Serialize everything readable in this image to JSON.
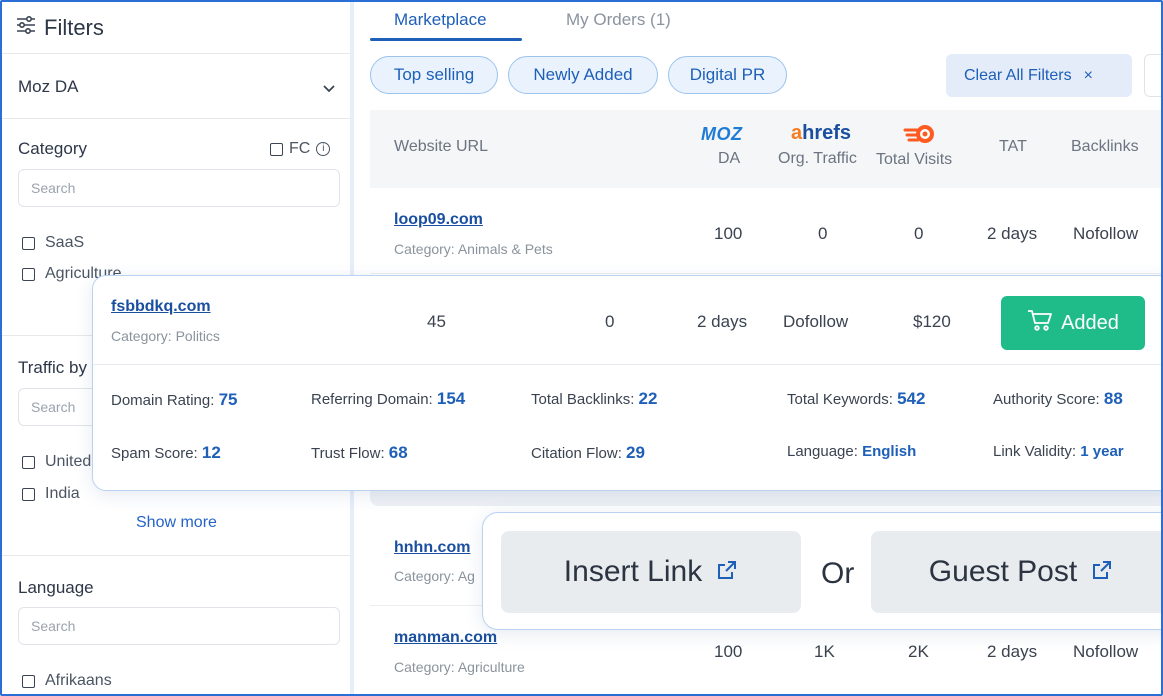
{
  "sidebar": {
    "title": "Filters",
    "moz_da": "Moz DA",
    "category": {
      "label": "Category",
      "fc_label": "FC",
      "search_placeholder": "Search",
      "options": [
        "SaaS",
        "Agriculture"
      ]
    },
    "traffic": {
      "label": "Traffic by",
      "search_placeholder": "Search",
      "options": [
        "United",
        "India"
      ],
      "show_more": "Show more"
    },
    "language": {
      "label": "Language",
      "search_placeholder": "Search",
      "options": [
        "Afrikaans"
      ]
    }
  },
  "tabs": {
    "marketplace": "Marketplace",
    "orders": "My Orders (1)"
  },
  "filters": {
    "pills": [
      "Top selling",
      "Newly Added",
      "Digital PR"
    ],
    "clear_all": "Clear All Filters",
    "clear_icon": "×"
  },
  "table": {
    "headers": {
      "website_url": "Website URL",
      "moz_logo": "MOZ",
      "da": "DA",
      "ahrefs_logo_a": "a",
      "ahrefs_logo_rest": "hrefs",
      "org_traffic": "Org. Traffic",
      "total_visits": "Total Visits",
      "tat": "TAT",
      "backlinks": "Backlinks"
    },
    "rows": [
      {
        "site": "loop09.com",
        "category": "Category: Animals & Pets",
        "da": "100",
        "traffic": "0",
        "visits": "0",
        "tat": "2 days",
        "backlinks": "Nofollow"
      },
      {
        "site": "hnhn.com",
        "category": "Category: Ag"
      },
      {
        "site": "manman.com",
        "category": "Category: Agriculture",
        "da": "100",
        "traffic": "1K",
        "visits": "2K",
        "tat": "2 days",
        "backlinks": "Nofollow"
      }
    ]
  },
  "expanded": {
    "site": "fsbbdkq.com",
    "category": "Category: Politics",
    "da": "45",
    "traffic": "0",
    "tat": "2 days",
    "backlinks": "Dofollow",
    "price": "$120",
    "added_label": "Added",
    "metrics": {
      "domain_rating_label": "Domain Rating:",
      "domain_rating": "75",
      "referring_domain_label": "Referring Domain:",
      "referring_domain": "154",
      "total_backlinks_label": "Total Backlinks:",
      "total_backlinks": "22",
      "total_keywords_label": "Total Keywords:",
      "total_keywords": "542",
      "authority_score_label": "Authority Score:",
      "authority_score": "88",
      "spam_score_label": "Spam Score:",
      "spam_score": "12",
      "trust_flow_label": "Trust Flow:",
      "trust_flow": "68",
      "citation_flow_label": "Citation Flow:",
      "citation_flow": "29",
      "language_label": "Language:",
      "language": "English",
      "link_validity_label": "Link Validity:",
      "link_validity": "1 year"
    }
  },
  "link_type": {
    "insert_link": "Insert Link",
    "or": "Or",
    "guest_post": "Guest Post"
  },
  "colors": {
    "accent": "#1e5fb8",
    "added_green": "#1fbc8a",
    "frame_border": "#2b6fd6"
  }
}
